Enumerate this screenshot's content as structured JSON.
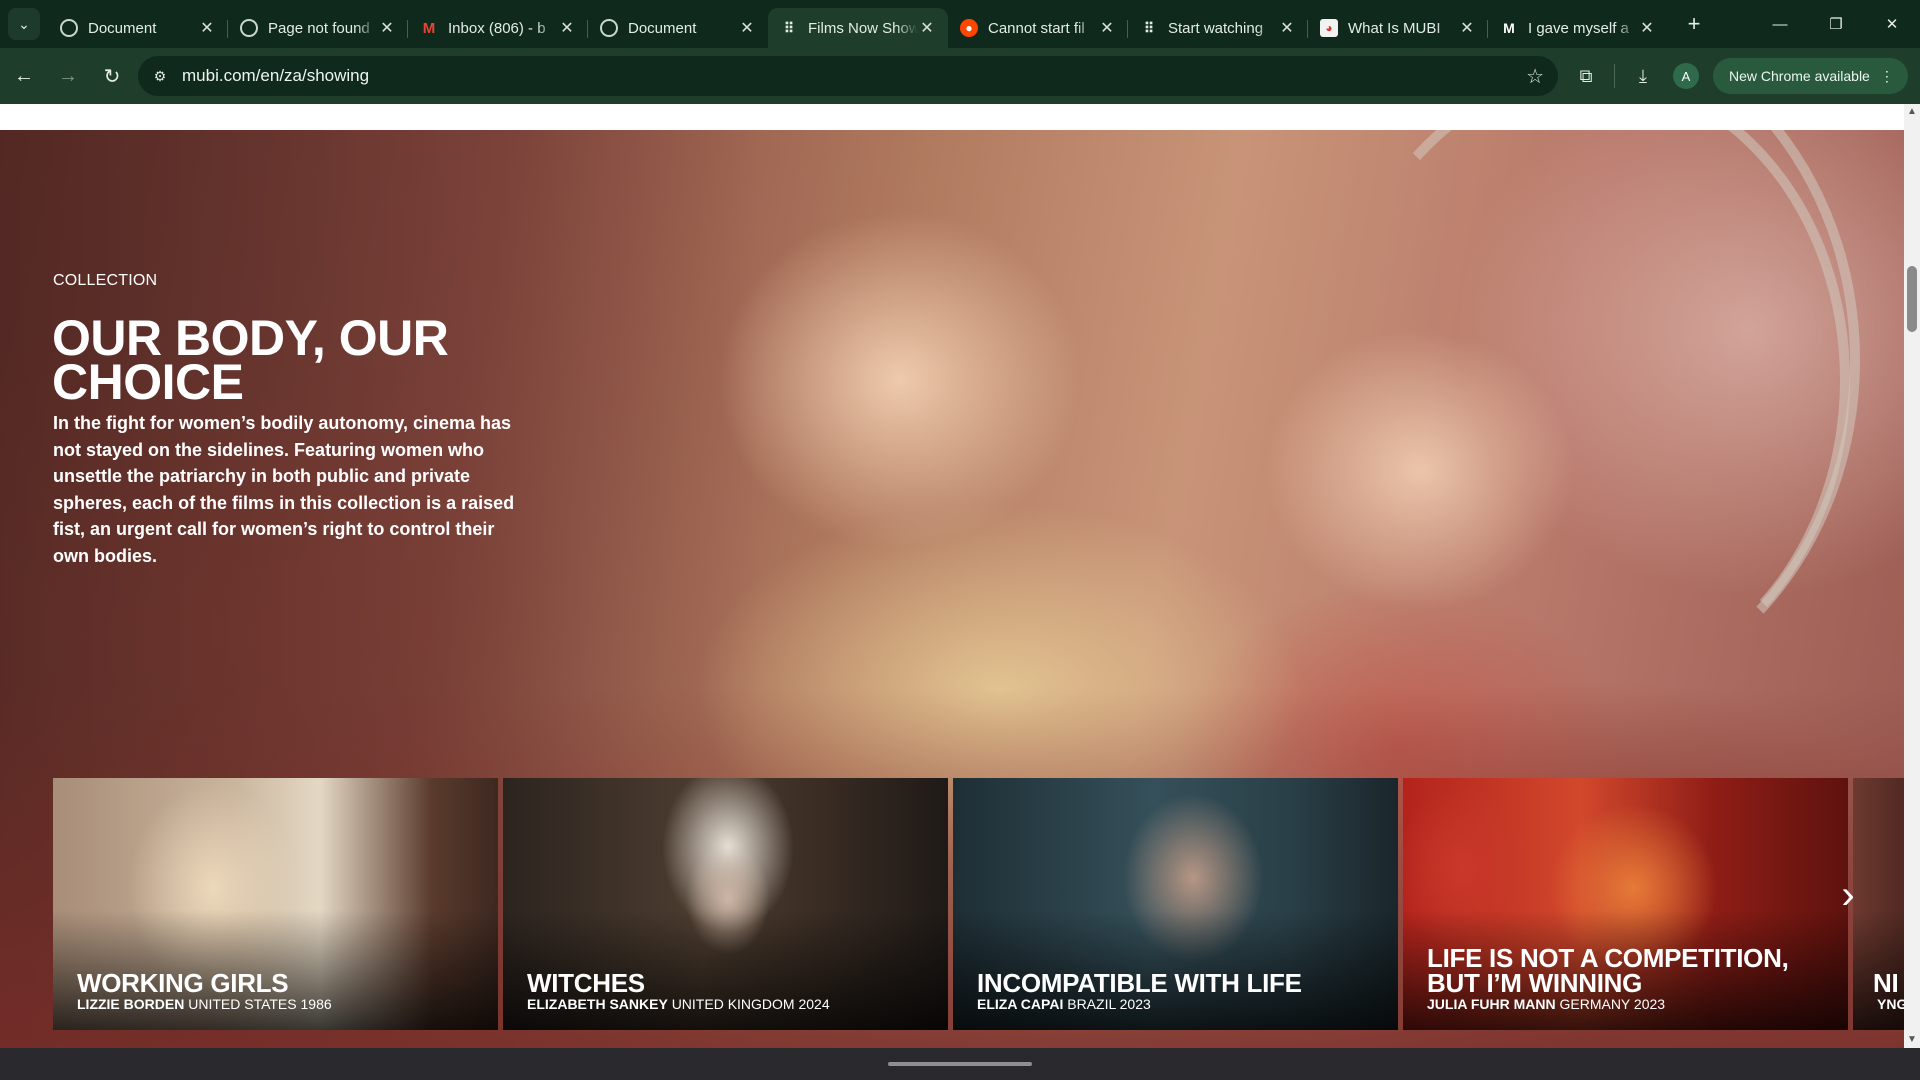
{
  "browser": {
    "tabs": [
      {
        "title": "Document",
        "favicon": "globe-icon",
        "active": false
      },
      {
        "title": "Page not found",
        "favicon": "globe-icon",
        "active": false
      },
      {
        "title": "Inbox (806) - b",
        "favicon": "gmail-icon",
        "active": false
      },
      {
        "title": "Document",
        "favicon": "globe-icon",
        "active": false
      },
      {
        "title": "Films Now Showing",
        "favicon": "mubi-dots-icon",
        "active": true
      },
      {
        "title": "Cannot start fil",
        "favicon": "reddit-icon",
        "active": false
      },
      {
        "title": "Start watching",
        "favicon": "mubi-dots-icon",
        "active": false
      },
      {
        "title": "What Is MUBI",
        "favicon": "mubi-logo-icon",
        "active": false
      },
      {
        "title": "I gave myself a",
        "favicon": "medium-icon",
        "active": false
      }
    ],
    "url": "mubi.com/en/za/showing",
    "profile_initial": "A",
    "update_label": "New Chrome available"
  },
  "hero": {
    "eyebrow": "COLLECTION",
    "title": "OUR BODY, OUR CHOICE",
    "description": "In the fight for women’s bodily autonomy, cinema has not stayed on the sidelines. Featuring women who unsettle the patriarchy in both public and private spheres, each of the films in this collection is a raised fist, an urgent call for women’s right to control their own bodies."
  },
  "films": [
    {
      "title": "WORKING GIRLS",
      "director": "LIZZIE BORDEN",
      "meta": "UNITED STATES 1986"
    },
    {
      "title": "WITCHES",
      "director": "ELIZABETH SANKEY",
      "meta": "UNITED KINGDOM 2024"
    },
    {
      "title": "INCOMPATIBLE WITH LIFE",
      "director": "ELIZA CAPAI",
      "meta": "BRAZIL 2023"
    },
    {
      "title": "LIFE IS NOT A COMPETITION, BUT I’M WINNING",
      "director": "JULIA FUHR MANN",
      "meta": "GERMANY 2023"
    },
    {
      "title": "NI",
      "director": "YNG",
      "meta": ""
    }
  ]
}
